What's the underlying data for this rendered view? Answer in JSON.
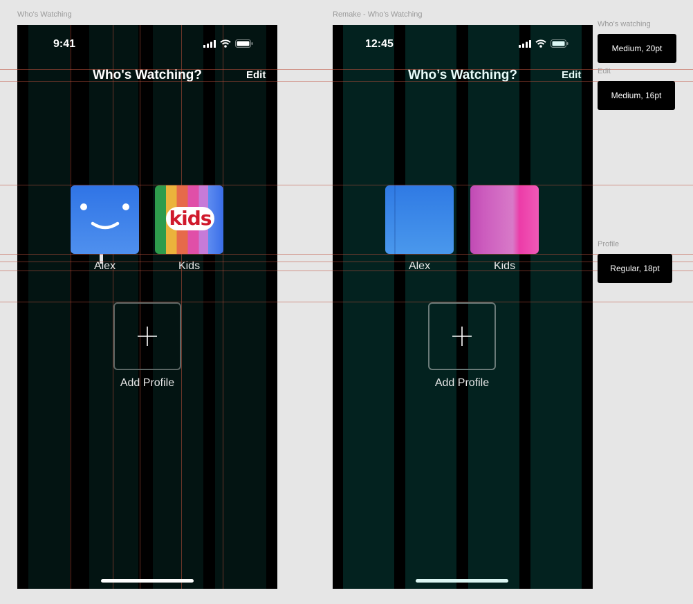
{
  "frames": {
    "original_label": "Who's Watching",
    "remake_label": "Remake - Who's Watching"
  },
  "original": {
    "status_time": "9:41",
    "title": "Who's Watching?",
    "edit_label": "Edit",
    "profiles": [
      {
        "name": "Alex",
        "avatar": "smiley-face-icon"
      },
      {
        "name": "Kids",
        "avatar": "kids-logo-icon",
        "logo_text": "kids"
      }
    ],
    "add_profile_label": "Add Profile"
  },
  "remake": {
    "status_time": "12:45",
    "title": "Who’s Watching?",
    "edit_label": "Edit",
    "profiles": [
      {
        "name": "Alex"
      },
      {
        "name": "Kids"
      }
    ],
    "add_profile_label": "Add Profile"
  },
  "specs": [
    {
      "label": "Who's watching",
      "value": "Medium, 20pt"
    },
    {
      "label": "Edit",
      "value": "Medium, 16pt"
    },
    {
      "label": "Profile",
      "value": "Regular, 18pt"
    }
  ],
  "colors": {
    "canvas": "#e6e6e6",
    "original_column": "#031412",
    "remake_column": "#03221f",
    "guide": "#be503c",
    "alex_blue": "#3a7ee0",
    "kids_pink": "#d05cc0"
  },
  "icons": {
    "signal": "cellular-signal-icon",
    "wifi": "wifi-icon",
    "battery": "battery-icon",
    "add": "plus-icon"
  }
}
